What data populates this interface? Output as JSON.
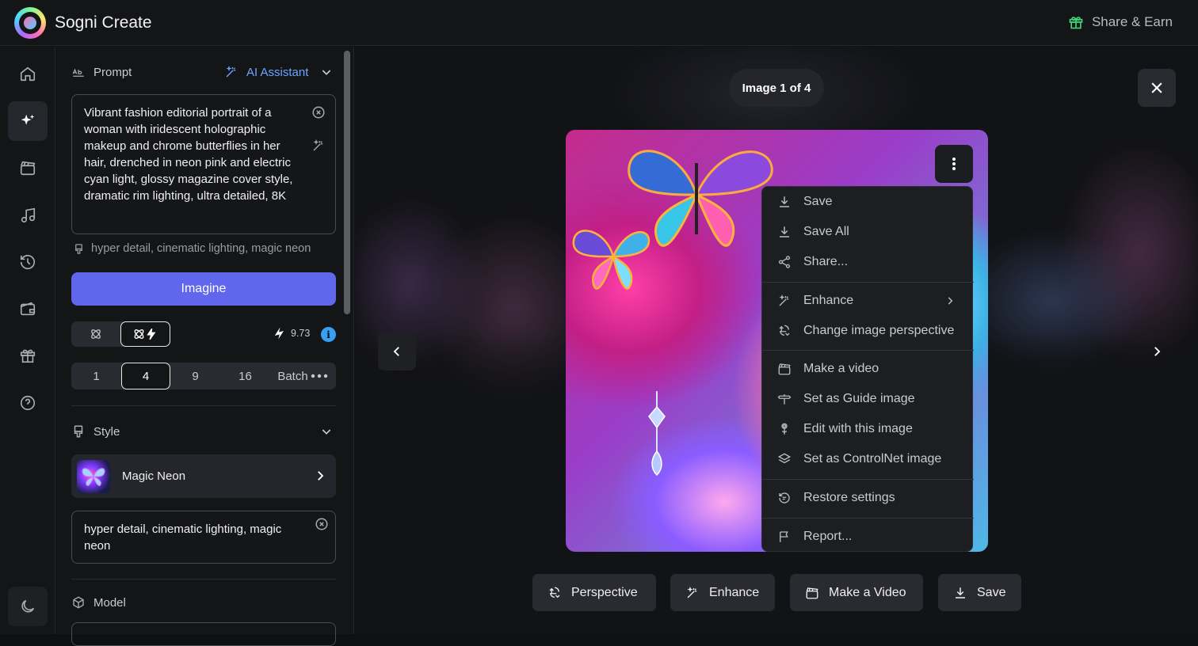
{
  "app": {
    "title": "Sogni Create",
    "share_earn": "Share & Earn"
  },
  "rail": {
    "items": [
      "home",
      "create",
      "video",
      "music",
      "history",
      "wallet",
      "rewards",
      "help",
      "theme"
    ]
  },
  "prompt": {
    "label": "Prompt",
    "ai_assistant": "AI Assistant",
    "text": "Vibrant fashion editorial portrait of a woman with iridescent holographic makeup and chrome butterflies in her hair, drenched in neon pink and electric cyan light, glossy magazine cover style, dramatic rim lighting, ultra detailed, 8K",
    "style_hint": "hyper detail, cinematic lighting, magic neon"
  },
  "imagine_label": "Imagine",
  "credits": "9.73",
  "info": "i",
  "counts": {
    "options": [
      "1",
      "4",
      "9",
      "16",
      "Batch"
    ],
    "selected": "4"
  },
  "style": {
    "label": "Style",
    "name": "Magic Neon",
    "prompt": "hyper detail, cinematic lighting, magic neon"
  },
  "model": {
    "label": "Model"
  },
  "viewer": {
    "pager": "Image 1 of 4"
  },
  "menu": {
    "items": [
      {
        "label": "Save",
        "icon": "download-icon"
      },
      {
        "label": "Save All",
        "icon": "download-icon"
      },
      {
        "label": "Share...",
        "icon": "share-icon"
      },
      {
        "label": "Enhance",
        "icon": "magic-wand-icon"
      },
      {
        "label": "Change image perspective",
        "icon": "perspective-icon"
      },
      {
        "label": "Make a video",
        "icon": "clapper-icon"
      },
      {
        "label": "Set as Guide image",
        "icon": "guide-icon"
      },
      {
        "label": "Edit with this image",
        "icon": "edit-flower-icon"
      },
      {
        "label": "Set as ControlNet image",
        "icon": "layers-icon"
      },
      {
        "label": "Restore settings",
        "icon": "restore-icon"
      },
      {
        "label": "Report...",
        "icon": "flag-icon"
      }
    ]
  },
  "actions": {
    "perspective": "Perspective",
    "enhance": "Enhance",
    "make_video": "Make a Video",
    "save": "Save"
  }
}
